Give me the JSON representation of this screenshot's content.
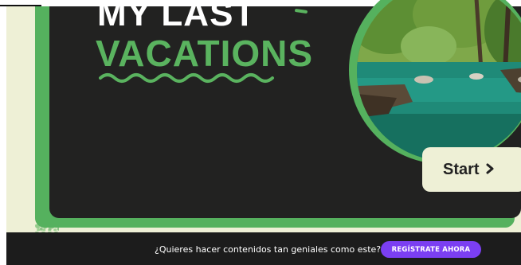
{
  "hero": {
    "title_line1": "MY LAST",
    "title_line2": "VACATIONS",
    "start_label": "Start",
    "start_icon": "chevron-right",
    "image_alt": "river-forest-photo"
  },
  "footer": {
    "prompt_text": "¿Quieres hacer contenidos tan geniales como este?",
    "cta_label": "REGÍSTRATE AHORA"
  },
  "colors": {
    "accent_green": "#5ab35f",
    "panel_dark": "#222221",
    "cream": "#eef0d6",
    "cta_purple": "#7b3ff2",
    "footer_bg": "#1c1c1c"
  }
}
